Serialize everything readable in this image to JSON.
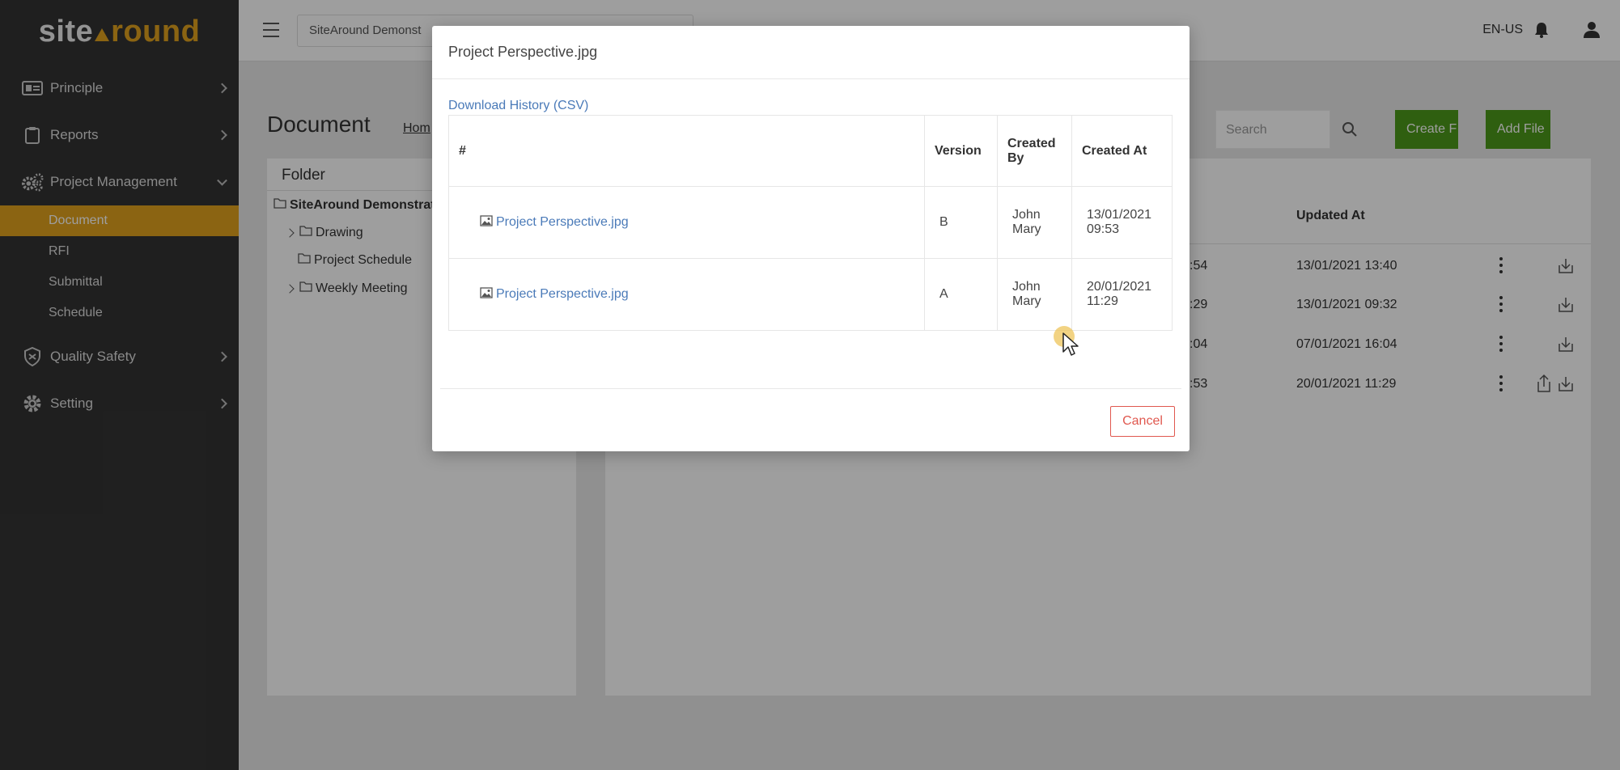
{
  "brand": {
    "logo_part1": "site",
    "logo_part2": "round"
  },
  "sidebar": {
    "items": [
      {
        "label": "Principle",
        "icon": "id-card-icon"
      },
      {
        "label": "Reports",
        "icon": "clipboard-icon"
      },
      {
        "label": "Project Management",
        "icon": "gears-icon",
        "expanded": true
      },
      {
        "label": "Quality Safety",
        "icon": "shield-icon"
      },
      {
        "label": "Setting",
        "icon": "gear-icon"
      }
    ],
    "sub_items": [
      "Document",
      "RFI",
      "Submittal",
      "Schedule"
    ],
    "active_sub": "Document"
  },
  "header": {
    "project": "SiteAround Demonst",
    "language": "EN-US"
  },
  "page": {
    "title": "Document",
    "breadcrumb": "Hom",
    "search_placeholder": "Search",
    "create_button": "Create F",
    "add_file_button": "Add File"
  },
  "folder": {
    "title": "Folder",
    "root": "SiteAround Demonstrat",
    "children": [
      "Drawing",
      "Project Schedule",
      "Weekly Meeting"
    ]
  },
  "file_list": {
    "updated_header": "Updated At",
    "rows": [
      {
        "created_partial": ":54",
        "updated": "13/01/2021 13:40"
      },
      {
        "created_partial": ":29",
        "updated": "13/01/2021 09:32"
      },
      {
        "created_partial": ":04",
        "updated": "07/01/2021 16:04"
      },
      {
        "created_partial": ":53",
        "updated": "20/01/2021 11:29"
      }
    ]
  },
  "modal": {
    "title": "Project Perspective.jpg",
    "csv_link": "Download History (CSV)",
    "columns": [
      "#",
      "Version",
      "Created By",
      "Created At"
    ],
    "rows": [
      {
        "file": "Project Perspective.jpg",
        "version": "B",
        "created_by": "John Mary",
        "created_at": "13/01/2021 09:53"
      },
      {
        "file": "Project Perspective.jpg",
        "version": "A",
        "created_by": "John Mary",
        "created_at": "20/01/2021 11:29"
      }
    ],
    "cancel": "Cancel"
  },
  "colors": {
    "accent": "#e0a21e",
    "sidebar": "#333333",
    "green": "#4c9a1a",
    "link": "#4a7ab8",
    "cancel": "#e0584f"
  }
}
